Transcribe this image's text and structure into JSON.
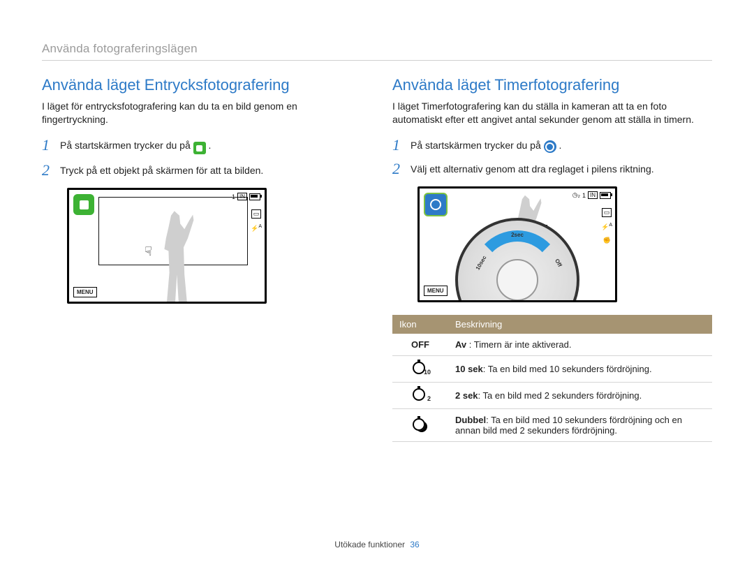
{
  "breadcrumb": "Använda fotograferingslägen",
  "footer": {
    "label": "Utökade funktioner",
    "page": "36"
  },
  "left": {
    "heading": "Använda läget Entrycksfotografering",
    "lead": "I läget för entrycksfotografering kan du ta en bild genom en fingertryckning.",
    "steps": [
      {
        "num": "1",
        "text_before": "På startskärmen trycker du på ",
        "text_after": "."
      },
      {
        "num": "2",
        "text": "Tryck på ett objekt på skärmen för att ta bilden."
      }
    ],
    "preview": {
      "count": "1",
      "storage": "IN",
      "menu": "MENU"
    }
  },
  "right": {
    "heading": "Använda läget Timerfotografering",
    "lead": "I läget Timerfotografering kan du ställa in kameran att ta en foto automatiskt efter ett angivet antal sekunder genom att ställa in timern.",
    "steps": [
      {
        "num": "1",
        "text_before": "På startskärmen trycker du på ",
        "text_after": "."
      },
      {
        "num": "2",
        "text": "Välj ett alternativ genom att dra reglaget i pilens riktning."
      }
    ],
    "preview": {
      "count": "1",
      "storage": "IN",
      "menu": "MENU",
      "dial_labels": [
        "2sec",
        "10sec",
        "Off"
      ]
    },
    "table": {
      "headers": {
        "icon": "Ikon",
        "desc": "Beskrivning"
      },
      "rows": [
        {
          "icon_text": "OFF",
          "term": "Av",
          "sep": " : ",
          "desc": "Timern är inte aktiverad."
        },
        {
          "icon_sub": "10",
          "term": "10 sek",
          "sep": ": ",
          "desc": "Ta en bild med 10 sekunders fördröjning."
        },
        {
          "icon_sub": "2",
          "term": "2 sek",
          "sep": ": ",
          "desc": "Ta en bild med 2 sekunders fördröjning."
        },
        {
          "icon_double": true,
          "term": "Dubbel",
          "sep": ": ",
          "desc": "Ta en bild med 10 sekunders fördröjning och en annan bild med 2 sekunders fördröjning."
        }
      ]
    }
  }
}
